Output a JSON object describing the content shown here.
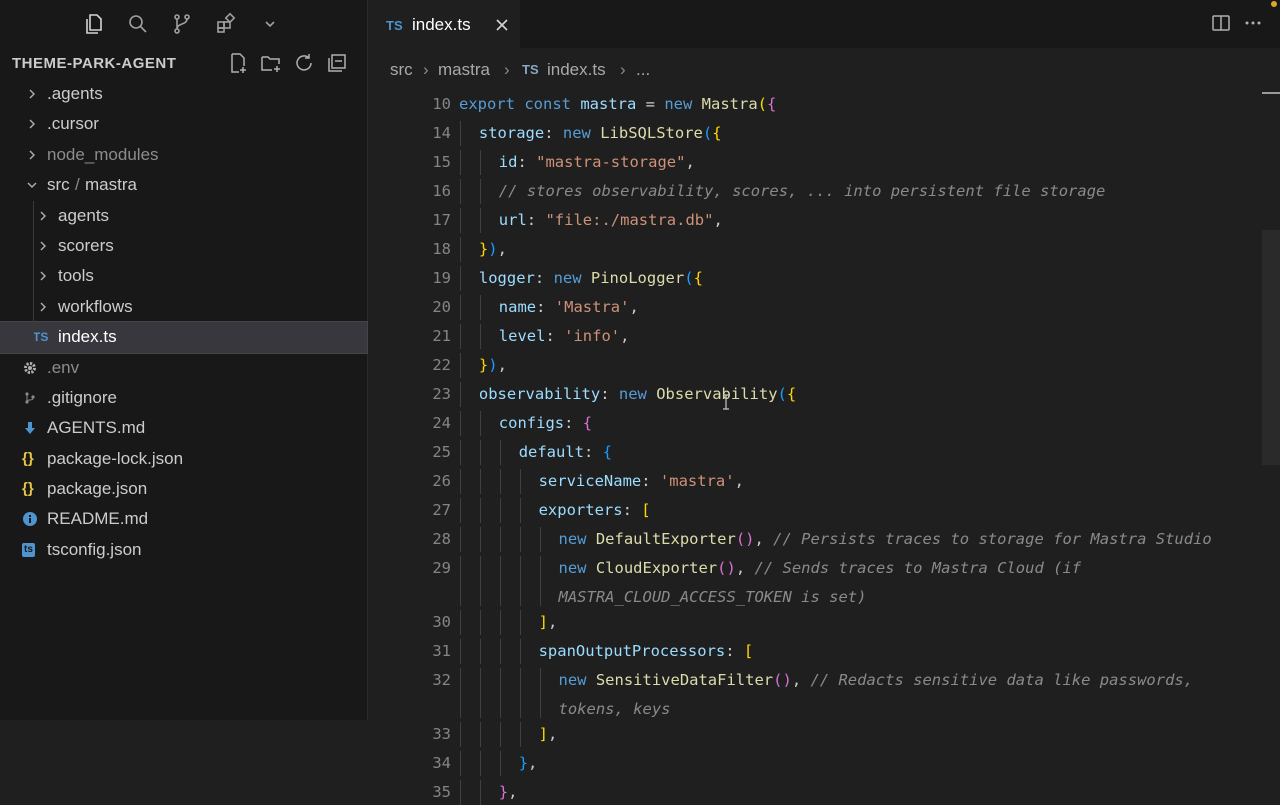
{
  "sidebar": {
    "title": "THEME-PARK-AGENT",
    "top_icons": [
      "explorer-icon",
      "search-icon",
      "source-control-icon",
      "extensions-icon",
      "chevron-down-icon"
    ],
    "header_actions": [
      "new-file-icon",
      "new-folder-icon",
      "refresh-icon",
      "collapse-all-icon"
    ],
    "tree": [
      {
        "label": ".agents",
        "type": "folder",
        "depth": 0
      },
      {
        "label": ".cursor",
        "type": "folder",
        "depth": 0
      },
      {
        "label": "node_modules",
        "type": "folder",
        "depth": 0,
        "dim": true
      },
      {
        "label": "src",
        "sep": "/",
        "label2": "mastra",
        "type": "folder-open",
        "depth": 0
      },
      {
        "label": "agents",
        "type": "folder",
        "depth": 1
      },
      {
        "label": "scorers",
        "type": "folder",
        "depth": 1
      },
      {
        "label": "tools",
        "type": "folder",
        "depth": 1
      },
      {
        "label": "workflows",
        "type": "folder",
        "depth": 1
      },
      {
        "label": "index.ts",
        "type": "ts",
        "icon": "TS",
        "depth": 1,
        "selected": true
      },
      {
        "label": ".env",
        "type": "gear",
        "depth": 0,
        "dim": true
      },
      {
        "label": ".gitignore",
        "type": "git",
        "depth": 0
      },
      {
        "label": "AGENTS.md",
        "type": "md",
        "depth": 0
      },
      {
        "label": "package-lock.json",
        "type": "json",
        "icon": "{}",
        "depth": 0
      },
      {
        "label": "package.json",
        "type": "json",
        "icon": "{}",
        "depth": 0
      },
      {
        "label": "README.md",
        "type": "info",
        "depth": 0
      },
      {
        "label": "tsconfig.json",
        "type": "tsconfig",
        "icon": "ts",
        "depth": 0
      }
    ]
  },
  "editor": {
    "tab": {
      "icon": "TS",
      "name": "index.ts"
    },
    "breadcrumbs": {
      "p1": "src",
      "p2": "mastra",
      "icon": "TS",
      "p3": "index.ts",
      "p4": "..."
    },
    "lines": [
      {
        "n": "10",
        "indent": 0,
        "t": [
          [
            "k",
            "export const "
          ],
          [
            "v",
            "mastra"
          ],
          [
            "p",
            " = "
          ],
          [
            "k",
            "new "
          ],
          [
            "f",
            "Mastra"
          ],
          [
            "b1",
            "("
          ],
          [
            "b2",
            "{"
          ]
        ]
      },
      {
        "n": "14",
        "indent": 1,
        "t": [
          [
            "v",
            "storage"
          ],
          [
            "p",
            ": "
          ],
          [
            "k",
            "new "
          ],
          [
            "f",
            "LibSQLStore"
          ],
          [
            "b3",
            "("
          ],
          [
            "b1",
            "{"
          ]
        ]
      },
      {
        "n": "15",
        "indent": 2,
        "t": [
          [
            "v",
            "id"
          ],
          [
            "p",
            ": "
          ],
          [
            "s",
            "\"mastra-storage\""
          ],
          [
            "p",
            ","
          ]
        ]
      },
      {
        "n": "16",
        "indent": 2,
        "t": [
          [
            "cm",
            "// stores observability, scores, ... into persistent file storage"
          ]
        ]
      },
      {
        "n": "17",
        "indent": 2,
        "t": [
          [
            "v",
            "url"
          ],
          [
            "p",
            ": "
          ],
          [
            "s",
            "\"file:./mastra.db\""
          ],
          [
            "p",
            ","
          ]
        ]
      },
      {
        "n": "18",
        "indent": 1,
        "t": [
          [
            "b1",
            "}"
          ],
          [
            "b3",
            ")"
          ],
          [
            "p",
            ","
          ]
        ]
      },
      {
        "n": "19",
        "indent": 1,
        "t": [
          [
            "v",
            "logger"
          ],
          [
            "p",
            ": "
          ],
          [
            "k",
            "new "
          ],
          [
            "f",
            "PinoLogger"
          ],
          [
            "b3",
            "("
          ],
          [
            "b1",
            "{"
          ]
        ]
      },
      {
        "n": "20",
        "indent": 2,
        "t": [
          [
            "v",
            "name"
          ],
          [
            "p",
            ": "
          ],
          [
            "s",
            "'Mastra'"
          ],
          [
            "p",
            ","
          ]
        ]
      },
      {
        "n": "21",
        "indent": 2,
        "t": [
          [
            "v",
            "level"
          ],
          [
            "p",
            ": "
          ],
          [
            "s",
            "'info'"
          ],
          [
            "p",
            ","
          ]
        ]
      },
      {
        "n": "22",
        "indent": 1,
        "t": [
          [
            "b1",
            "}"
          ],
          [
            "b3",
            ")"
          ],
          [
            "p",
            ","
          ]
        ]
      },
      {
        "n": "23",
        "indent": 1,
        "t": [
          [
            "v",
            "observability"
          ],
          [
            "p",
            ": "
          ],
          [
            "k",
            "new "
          ],
          [
            "f",
            "Observability"
          ],
          [
            "b3",
            "("
          ],
          [
            "b1",
            "{"
          ]
        ]
      },
      {
        "n": "24",
        "indent": 2,
        "t": [
          [
            "v",
            "configs"
          ],
          [
            "p",
            ": "
          ],
          [
            "b2",
            "{"
          ]
        ]
      },
      {
        "n": "25",
        "indent": 3,
        "t": [
          [
            "v",
            "default"
          ],
          [
            "p",
            ": "
          ],
          [
            "b3",
            "{"
          ]
        ]
      },
      {
        "n": "26",
        "indent": 4,
        "t": [
          [
            "v",
            "serviceName"
          ],
          [
            "p",
            ": "
          ],
          [
            "s",
            "'mastra'"
          ],
          [
            "p",
            ","
          ]
        ]
      },
      {
        "n": "27",
        "indent": 4,
        "t": [
          [
            "v",
            "exporters"
          ],
          [
            "p",
            ": "
          ],
          [
            "b1",
            "["
          ]
        ]
      },
      {
        "n": "28",
        "indent": 5,
        "t": [
          [
            "k",
            "new "
          ],
          [
            "f",
            "DefaultExporter"
          ],
          [
            "b2",
            "()"
          ],
          [
            "p",
            ", "
          ],
          [
            "cm",
            "// Persists traces to storage for Mastra Studio"
          ]
        ]
      },
      {
        "n": "29",
        "indent": 5,
        "t": [
          [
            "k",
            "new "
          ],
          [
            "f",
            "CloudExporter"
          ],
          [
            "b2",
            "()"
          ],
          [
            "p",
            ", "
          ],
          [
            "cm",
            "// Sends traces to Mastra Cloud (if"
          ]
        ],
        "cont": [
          [
            "cm",
            "MASTRA_CLOUD_ACCESS_TOKEN is set)"
          ]
        ]
      },
      {
        "n": "30",
        "indent": 4,
        "t": [
          [
            "b1",
            "]"
          ],
          [
            "p",
            ","
          ]
        ]
      },
      {
        "n": "31",
        "indent": 4,
        "t": [
          [
            "v",
            "spanOutputProcessors"
          ],
          [
            "p",
            ": "
          ],
          [
            "b1",
            "["
          ]
        ]
      },
      {
        "n": "32",
        "indent": 5,
        "t": [
          [
            "k",
            "new "
          ],
          [
            "f",
            "SensitiveDataFilter"
          ],
          [
            "b2",
            "()"
          ],
          [
            "p",
            ", "
          ],
          [
            "cm",
            "// Redacts sensitive data like passwords,"
          ]
        ],
        "cont": [
          [
            "cm",
            "tokens, keys"
          ]
        ]
      },
      {
        "n": "33",
        "indent": 4,
        "t": [
          [
            "b1",
            "]"
          ],
          [
            "p",
            ","
          ]
        ]
      },
      {
        "n": "34",
        "indent": 3,
        "t": [
          [
            "b3",
            "}"
          ],
          [
            "p",
            ","
          ]
        ]
      },
      {
        "n": "35",
        "indent": 2,
        "t": [
          [
            "b2",
            "}"
          ],
          [
            "p",
            ","
          ]
        ]
      }
    ]
  },
  "colors": {
    "accent": "#4e94ce",
    "keyword": "#569cd6",
    "string": "#ce9178",
    "function": "#dcdcaa",
    "comment": "#8a8a8a"
  }
}
